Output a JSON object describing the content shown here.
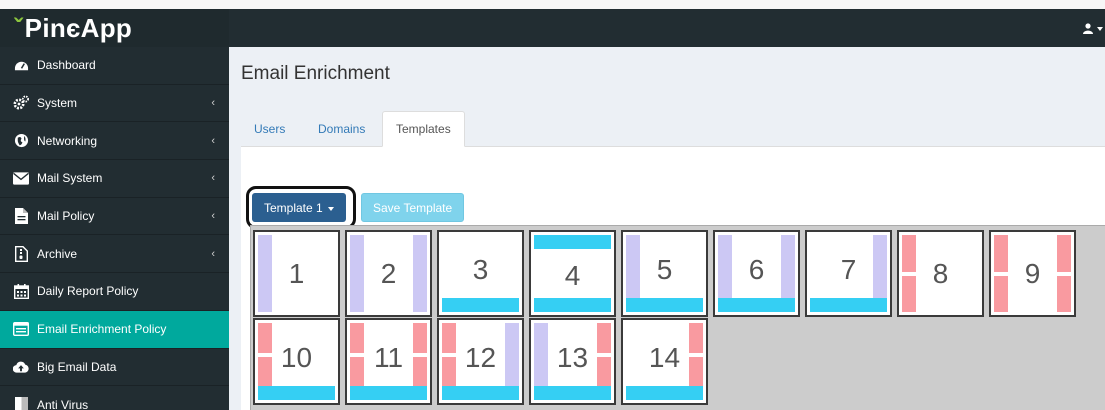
{
  "app": {
    "logo_mark": "ˇ",
    "logo_text": "PinєApp"
  },
  "colors": {
    "sidebar_bg": "#222d32",
    "active_item": "#00a99d",
    "primary_button": "#2b5f90",
    "save_button": "#7fd3ec",
    "strip_lavender": "#ccc8f4",
    "strip_pink": "#f99aa0",
    "strip_cyan": "#35cff3"
  },
  "sidebar": {
    "items": [
      {
        "label": "Dashboard",
        "icon": "dashboard-icon",
        "chevron": false
      },
      {
        "label": "System",
        "icon": "cogs-icon",
        "chevron": true
      },
      {
        "label": "Networking",
        "icon": "globe-icon",
        "chevron": true
      },
      {
        "label": "Mail System",
        "icon": "envelope-icon",
        "chevron": true
      },
      {
        "label": "Mail Policy",
        "icon": "file-icon",
        "chevron": true
      },
      {
        "label": "Archive",
        "icon": "archive-file-icon",
        "chevron": true
      },
      {
        "label": "Daily Report Policy",
        "icon": "calendar-icon",
        "chevron": false
      },
      {
        "label": "Email Enrichment Policy",
        "icon": "list-box-icon",
        "chevron": false,
        "active": true
      },
      {
        "label": "Big Email Data",
        "icon": "cloud-upload-icon",
        "chevron": false
      },
      {
        "label": "Anti Virus",
        "icon": "shield-icon",
        "chevron": false
      }
    ],
    "chevron_glyph": "‹"
  },
  "page": {
    "title": "Email Enrichment"
  },
  "tabs": [
    {
      "label": "Users",
      "active": false
    },
    {
      "label": "Domains",
      "active": false
    },
    {
      "label": "Templates",
      "active": true
    }
  ],
  "toolbar": {
    "template_select": "Template 1",
    "save_button": "Save Template"
  },
  "templates": [
    {
      "label": "1",
      "left": "lav",
      "right": "",
      "top": "",
      "bottom": ""
    },
    {
      "label": "2",
      "left": "lav",
      "right": "lav",
      "top": "",
      "bottom": ""
    },
    {
      "label": "3",
      "left": "",
      "right": "",
      "top": "",
      "bottom": "cyan"
    },
    {
      "label": "4",
      "left": "",
      "right": "",
      "top": "cyan",
      "bottom": "cyan"
    },
    {
      "label": "5",
      "left": "lav",
      "right": "",
      "top": "",
      "bottom": "cyan"
    },
    {
      "label": "6",
      "left": "lav",
      "right": "lav",
      "top": "",
      "bottom": "cyan"
    },
    {
      "label": "7",
      "left": "",
      "right": "lav",
      "top": "",
      "bottom": "cyan"
    },
    {
      "label": "8",
      "left": "pink",
      "right": "",
      "top": "",
      "bottom": ""
    },
    {
      "label": "9",
      "left": "pink",
      "right": "pink",
      "top": "",
      "bottom": ""
    },
    {
      "label": "10",
      "left": "pink",
      "right": "",
      "top": "",
      "bottom": "cyan"
    },
    {
      "label": "11",
      "left": "pink",
      "right": "pink",
      "top": "",
      "bottom": "cyan"
    },
    {
      "label": "12",
      "left": "pink",
      "right": "lav",
      "top": "",
      "bottom": "cyan"
    },
    {
      "label": "13",
      "left": "lav",
      "right": "pink",
      "top": "",
      "bottom": "cyan"
    },
    {
      "label": "14",
      "left": "",
      "right": "pink",
      "top": "",
      "bottom": "cyan"
    }
  ]
}
